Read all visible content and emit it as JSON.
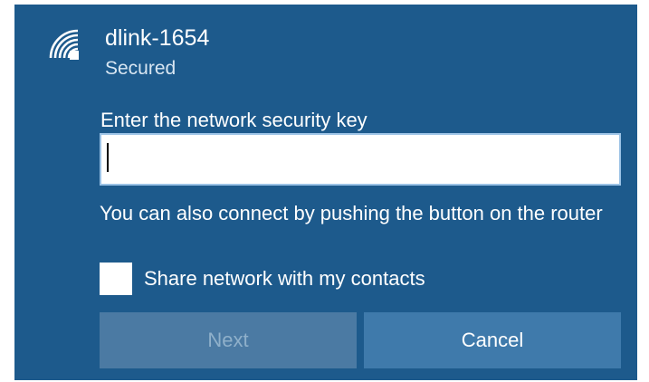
{
  "network": {
    "ssid": "dlink-1654",
    "status": "Secured",
    "icon": "wifi-secured-icon"
  },
  "form": {
    "key_label": "Enter the network security key",
    "key_value": "",
    "hint": "You can also connect by pushing the button on the router",
    "share_label": "Share network with my contacts",
    "share_checked": false
  },
  "buttons": {
    "next_label": "Next",
    "next_enabled": false,
    "cancel_label": "Cancel"
  },
  "colors": {
    "panel_background": "#1d5a8c",
    "button_disabled": "#4b7aa3",
    "button_enabled": "#3f7aab"
  }
}
